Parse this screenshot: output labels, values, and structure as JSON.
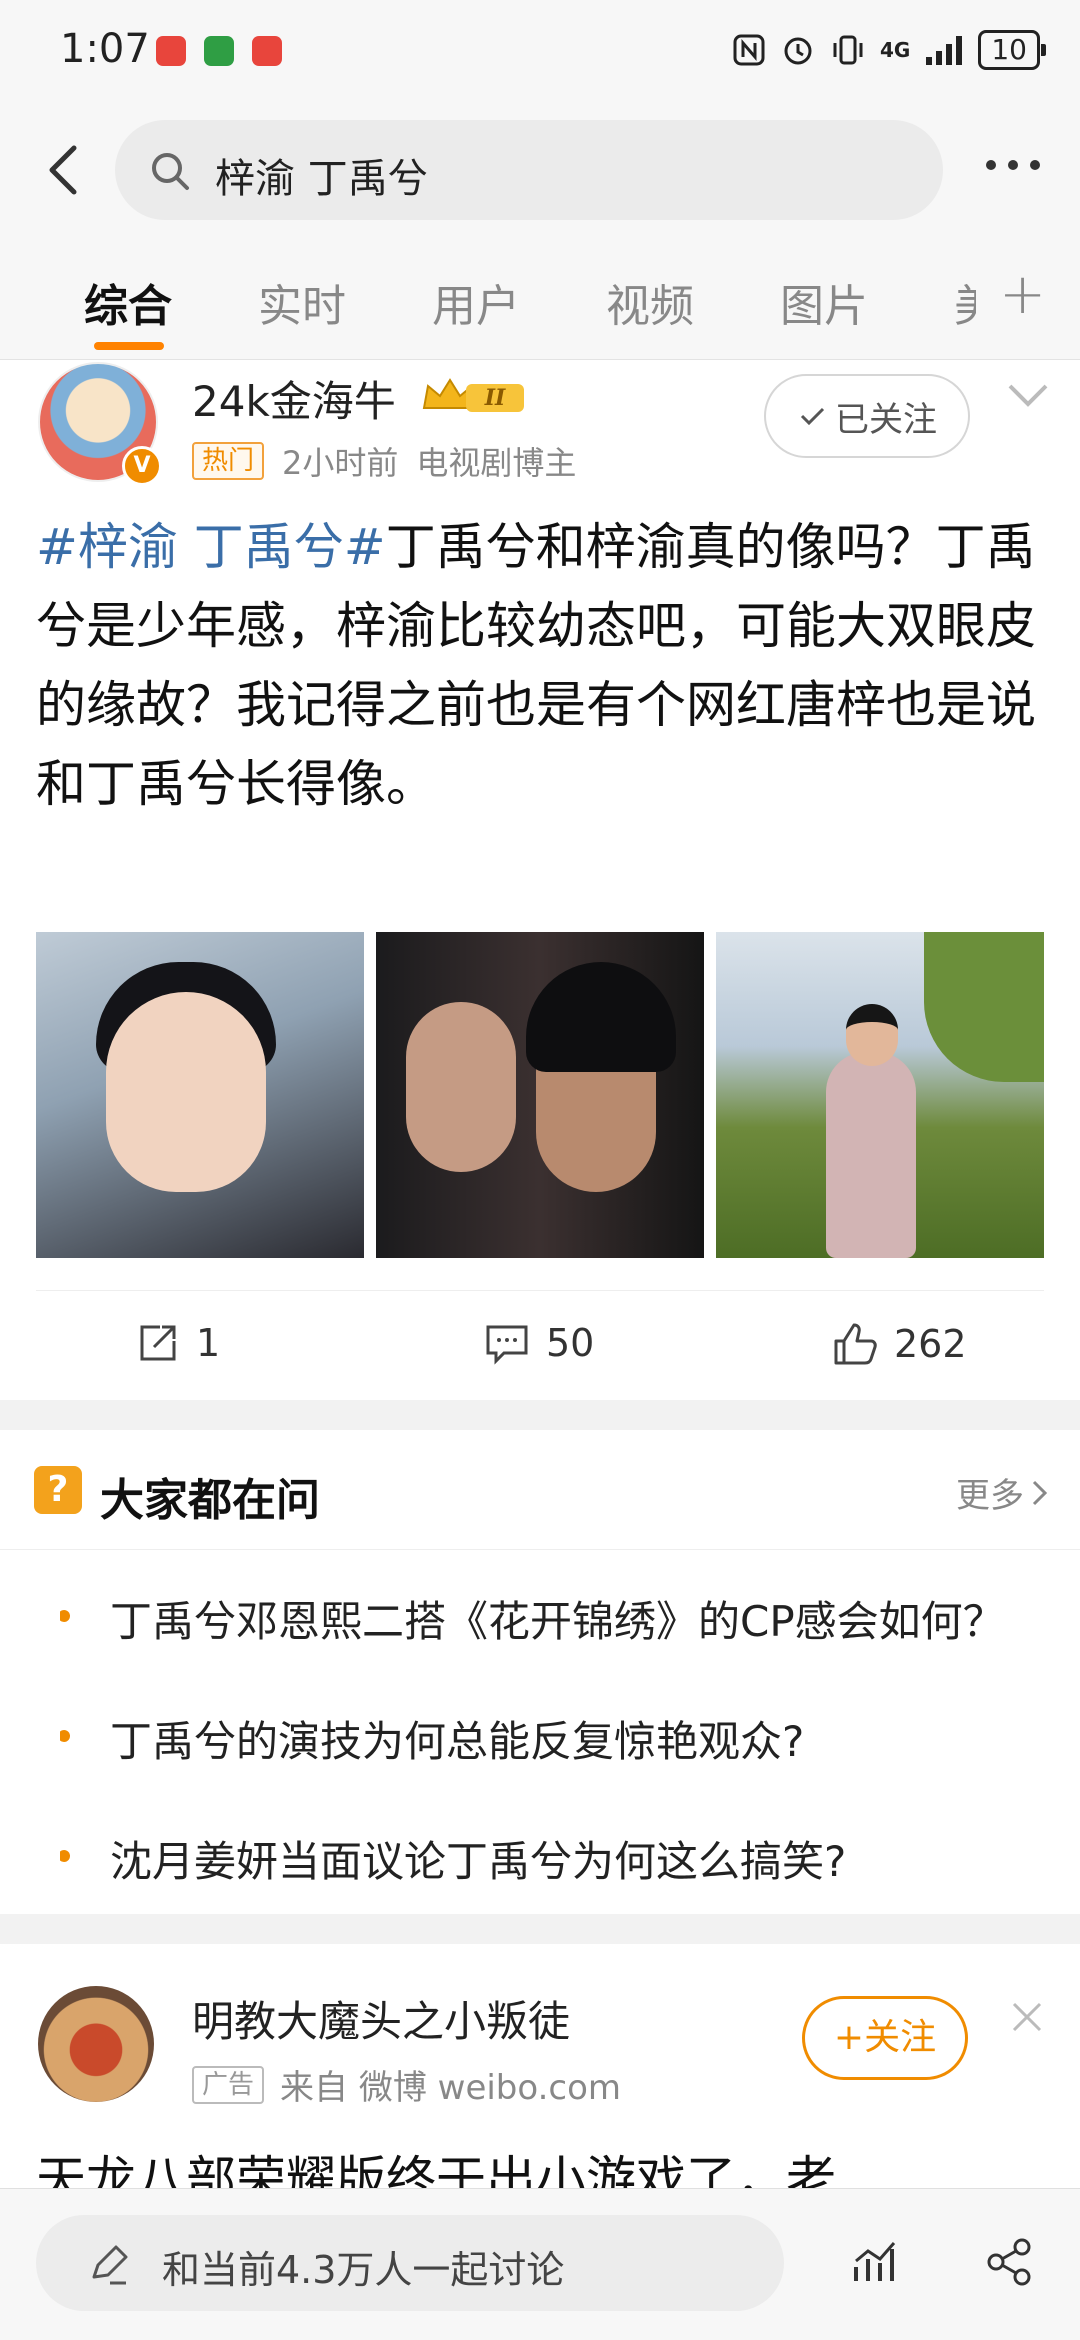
{
  "status_bar": {
    "time": "1:07",
    "network": "4G",
    "battery": "10",
    "app_icon_colors": [
      "#e8453c",
      "#2f9e44",
      "#e8453c"
    ]
  },
  "search": {
    "query": "梓渝 丁禹兮",
    "icons": [
      "back-arrow-icon",
      "search-icon",
      "more-dots-icon"
    ]
  },
  "tabs": {
    "items": [
      "综合",
      "实时",
      "用户",
      "视频",
      "图片",
      "美"
    ],
    "active": "综合"
  },
  "post": {
    "username": "24k金海牛",
    "level_badge": "II",
    "hot_tag": "热门",
    "time_ago": "2小时前",
    "role": "电视剧博主",
    "follow_state": "已关注",
    "topic": "#梓渝 丁禹兮#",
    "body": "丁禹兮和梓渝真的像吗？丁禹兮是少年感，梓渝比较幼态吧，可能大双眼皮的缘故？我记得之前也是有个网红唐梓也是说和丁禹兮长得像。",
    "repost_count": "1",
    "comment_count": "50",
    "like_count": "262"
  },
  "ask": {
    "title": "大家都在问",
    "more": "更多",
    "items": [
      "丁禹兮邓恩熙二搭《花开锦绣》的CP感会如何？",
      "丁禹兮的演技为何总能反复惊艳观众?",
      "沈月姜妍当面议论丁禹兮为何这么搞笑?"
    ]
  },
  "ad": {
    "name": "明教大魔头之小叛徒",
    "tag": "广告",
    "source": "来自 微博 weibo.com",
    "follow": "+关注",
    "text": "天龙八部荣耀版终于出小游戏了，老"
  },
  "bottom": {
    "discuss_label": "和当前4.3万人一起讨论"
  },
  "colors": {
    "accent": "#ff8200",
    "topic_link": "#3a6ea8"
  }
}
